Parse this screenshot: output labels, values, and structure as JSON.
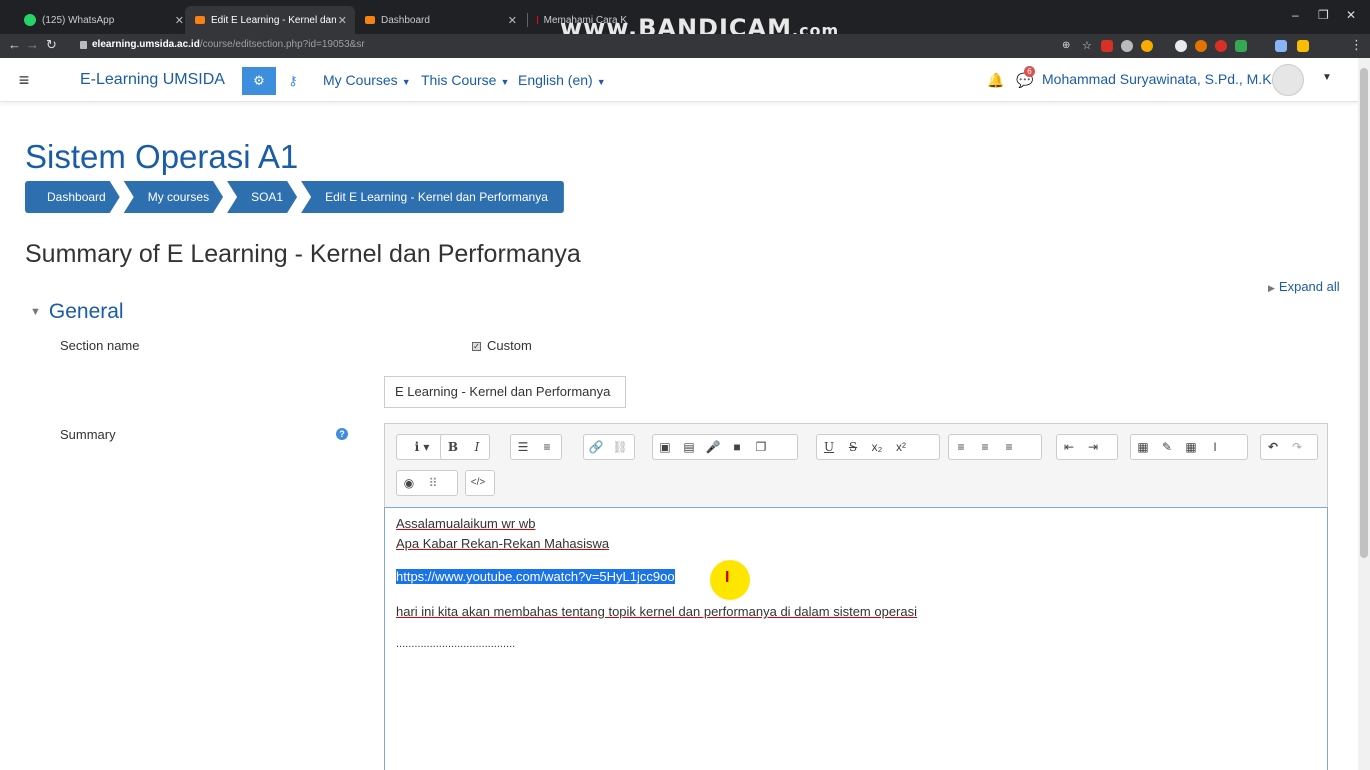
{
  "browser": {
    "tabs": [
      {
        "label": "(125) WhatsApp",
        "color": "#25d366"
      },
      {
        "label": "Edit E Learning - Kernel dan Perfo",
        "color": "#f98012"
      },
      {
        "label": "Dashboard",
        "color": "#f98012"
      },
      {
        "label": "Memahami Cara K",
        "color": "#ff0000"
      }
    ],
    "watermark": "www.BANDICAM",
    "watermark_suffix": ".com",
    "url_host": "elearning.umsida.ac.id",
    "url_path": "/course/editsection.php?id=19053&sr"
  },
  "navbar": {
    "brand": "E-Learning UMSIDA",
    "links": [
      "My Courses",
      "This Course",
      "English (en)"
    ],
    "notification_count": "6",
    "user_name": "Mohammad Suryawinata, S.Pd., M.Kom"
  },
  "page": {
    "title": "Sistem Operasi A1",
    "breadcrumb": [
      "Dashboard",
      "My courses",
      "SOA1",
      "Edit E Learning - Kernel dan Performanya"
    ],
    "heading": "Summary of E Learning - Kernel dan Performanya",
    "expand_all": "Expand all"
  },
  "form": {
    "section_general": "General",
    "section_name_label": "Section name",
    "custom_label": "Custom",
    "custom_checked": true,
    "section_name_value": "E Learning - Kernel dan Performanya",
    "summary_label": "Summary"
  },
  "editor": {
    "toolbar_row1": [
      "i ▾",
      "B",
      "I",
      "☰",
      "≡",
      "🔗",
      "⛓",
      "▣",
      "▤",
      "🎤",
      "■",
      "❐",
      "U",
      "S",
      "x₂",
      "x²",
      "≡",
      "≡",
      "≡",
      "⇤",
      "⇥",
      "▦",
      "✎",
      "▦",
      "I",
      "↶",
      "↷"
    ],
    "toolbar_row2": [
      "◉",
      "⠿",
      "</>"
    ],
    "lines": {
      "line1": "Assalamualaikum wr wb",
      "line2": "Apa Kabar Rekan-Rekan Mahasiswa",
      "link": "https://www.youtube.com/watch?v=5HyL1jcc9oo",
      "line4": "hari ini kita akan membahas tentang topik kernel dan performanya di dalam sistem operasi",
      "line5": "......................................."
    }
  }
}
